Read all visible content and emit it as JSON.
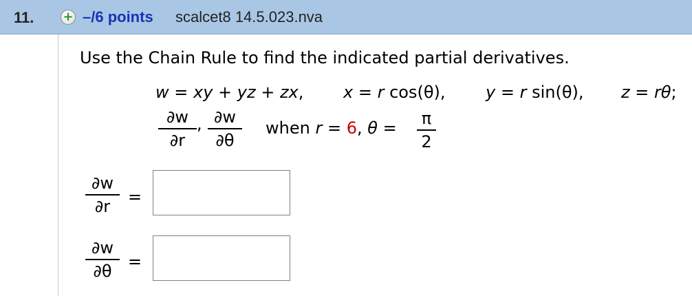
{
  "header": {
    "question_number": "11.",
    "plus_glyph": "+",
    "points": "–/6 points",
    "source": "scalcet8 14.5.023.nva"
  },
  "problem": {
    "prompt": "Use the Chain Rule to find the indicated partial derivatives.",
    "w_def": {
      "lhs": "w",
      "eq": " = ",
      "rhs": "xy + yz + zx",
      "sep": ","
    },
    "x_def": {
      "lhs": "x",
      "eq": " = ",
      "var": "r",
      "rhs": " cos(θ),",
      "sep": ""
    },
    "y_def": {
      "lhs": "y",
      "eq": " = ",
      "var": "r",
      "rhs": " sin(θ),",
      "sep": ""
    },
    "z_def": {
      "lhs": "z",
      "eq": " = ",
      "rhs": "rθ",
      "sep": ";"
    },
    "deriv1": {
      "num": "∂w",
      "den": "∂r"
    },
    "deriv_comma": ",",
    "deriv2": {
      "num": "∂w",
      "den": "∂θ"
    },
    "condition": {
      "prefix": "when ",
      "r_var": "r",
      "r_eq": " = ",
      "r_value": "6",
      "mid": ", ",
      "theta_var": "θ",
      "theta_eq": " = ",
      "theta_num": "π",
      "theta_den": "2"
    }
  },
  "answers": [
    {
      "num": "∂w",
      "den": "∂r",
      "equals": "=",
      "value": ""
    },
    {
      "num": "∂w",
      "den": "∂θ",
      "equals": "=",
      "value": ""
    }
  ],
  "colors": {
    "header_bg": "#a9c7e5",
    "points": "#1733b5",
    "given_value": "#cc0000",
    "plus": "#1f9a1f"
  }
}
